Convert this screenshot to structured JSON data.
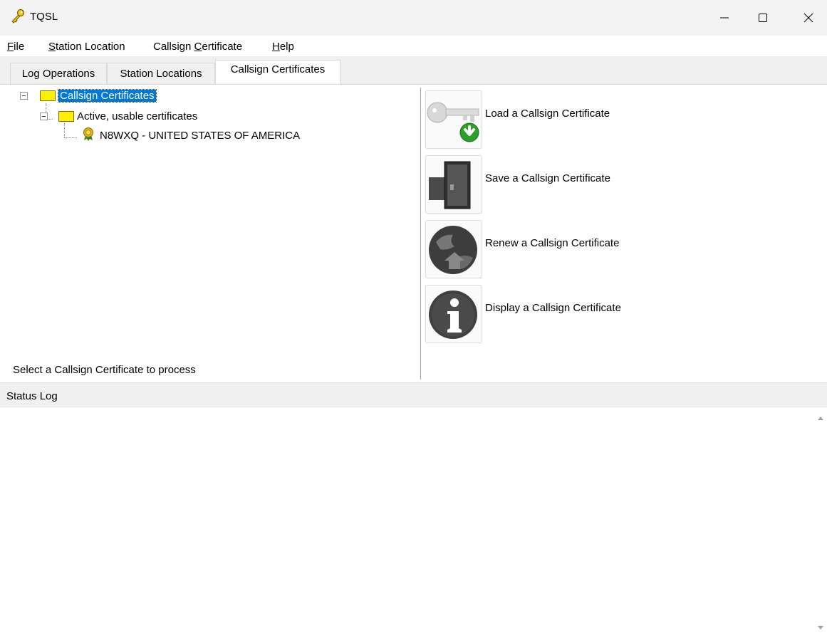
{
  "window": {
    "title": "TQSL"
  },
  "menu": {
    "items": [
      {
        "pre": "",
        "accel": "F",
        "post": "ile"
      },
      {
        "pre": "",
        "accel": "S",
        "post": "tation Location"
      },
      {
        "pre": "Callsign ",
        "accel": "C",
        "post": "ertificate"
      },
      {
        "pre": "",
        "accel": "H",
        "post": "elp"
      }
    ]
  },
  "tabs": [
    {
      "label": "Log Operations"
    },
    {
      "label": "Station Locations"
    },
    {
      "label": "Callsign Certificates"
    }
  ],
  "tree": {
    "root": "Callsign Certificates",
    "group": "Active, usable certificates",
    "certificate": "N8WXQ - UNITED STATES OF AMERICA"
  },
  "hint": "Select a Callsign Certificate to process",
  "actions": [
    {
      "label": "Load a Callsign Certificate"
    },
    {
      "label": "Save a Callsign Certificate"
    },
    {
      "label": "Renew a Callsign Certificate"
    },
    {
      "label": "Display a Callsign Certificate"
    }
  ],
  "status": {
    "title": "Status Log"
  }
}
